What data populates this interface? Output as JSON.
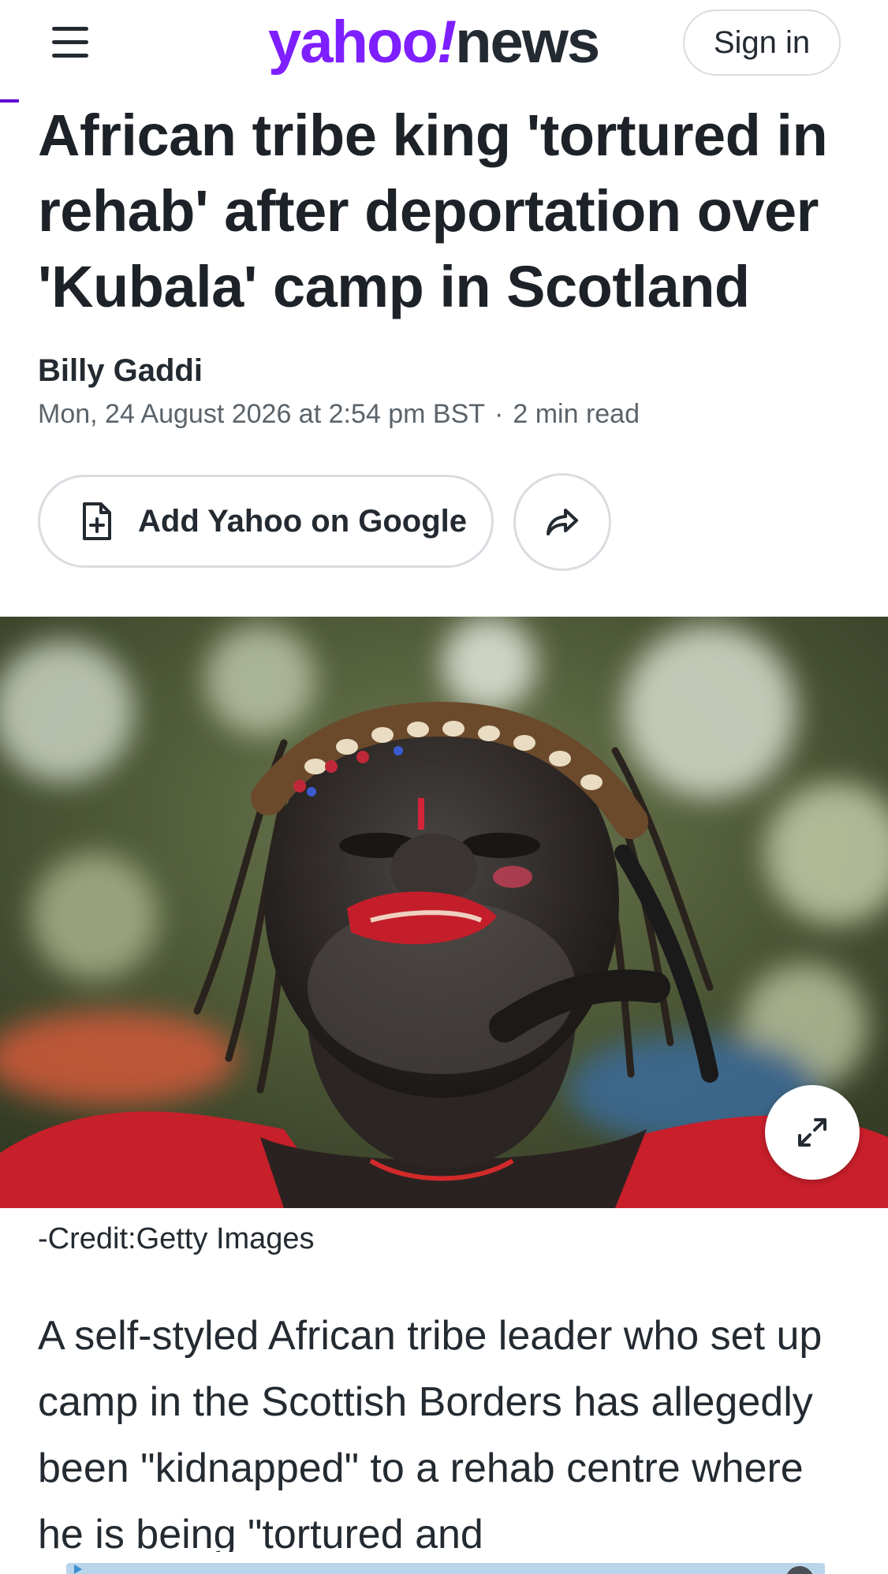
{
  "header": {
    "logo_yahoo": "yahoo",
    "logo_bang": "!",
    "logo_news": "news",
    "sign_in_label": "Sign in"
  },
  "article": {
    "headline": "African tribe king 'tortured in rehab' after deportation over 'Kubala' camp in Scotland",
    "author": "Billy Gaddi",
    "date": "Mon, 24 August 2026 at 2:54 pm BST",
    "separator": "·",
    "read_time": "2 min read",
    "image_credit": "-Credit:Getty Images",
    "body_first_paragraph": "A self-styled African tribe leader who set up camp in the Scottish Borders has allegedly been \"kidnapped\" to a rehab centre where he is being \"tortured and"
  },
  "actions": {
    "add_google_label": "Add Yahoo on Google"
  },
  "icons": {
    "menu": "hamburger-icon",
    "add_doc": "document-plus-icon",
    "share": "share-arrow-icon",
    "expand": "expand-icon"
  },
  "colors": {
    "brand_purple": "#7e1fff",
    "text_dark": "#232a31",
    "text_muted": "#5b636a"
  }
}
